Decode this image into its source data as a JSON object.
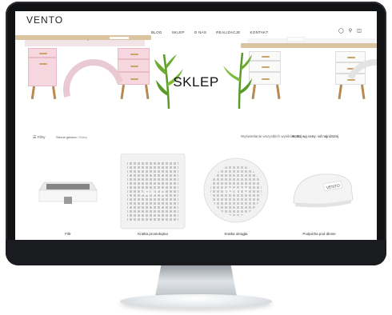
{
  "site": {
    "logo": "VENTO",
    "nav": [
      "BLOG",
      "SKLEP",
      "O NAS",
      "REALIZACJE",
      "KONTAKT"
    ],
    "hero_title": "SKLEP"
  },
  "toolbar": {
    "filters_label": "Filtry",
    "breadcrumb_home": "Strona główna",
    "breadcrumb_sep": " / ",
    "breadcrumb_current": "Sklep",
    "results_text": "Wyświetlanie wszystkich wyników: 25",
    "sort_value": "Sortuj wg ceny: od najniższej"
  },
  "products": [
    {
      "name": "Filtr"
    },
    {
      "name": "Kratka prostokątna"
    },
    {
      "name": "Kratka okrągła"
    },
    {
      "name": "Podpórka pod dłonie"
    }
  ],
  "product_brand": "VENTO",
  "colors": {
    "accent_pink": "#f6d7df",
    "wood": "#d9c49f",
    "plant": "#6cab2f"
  }
}
